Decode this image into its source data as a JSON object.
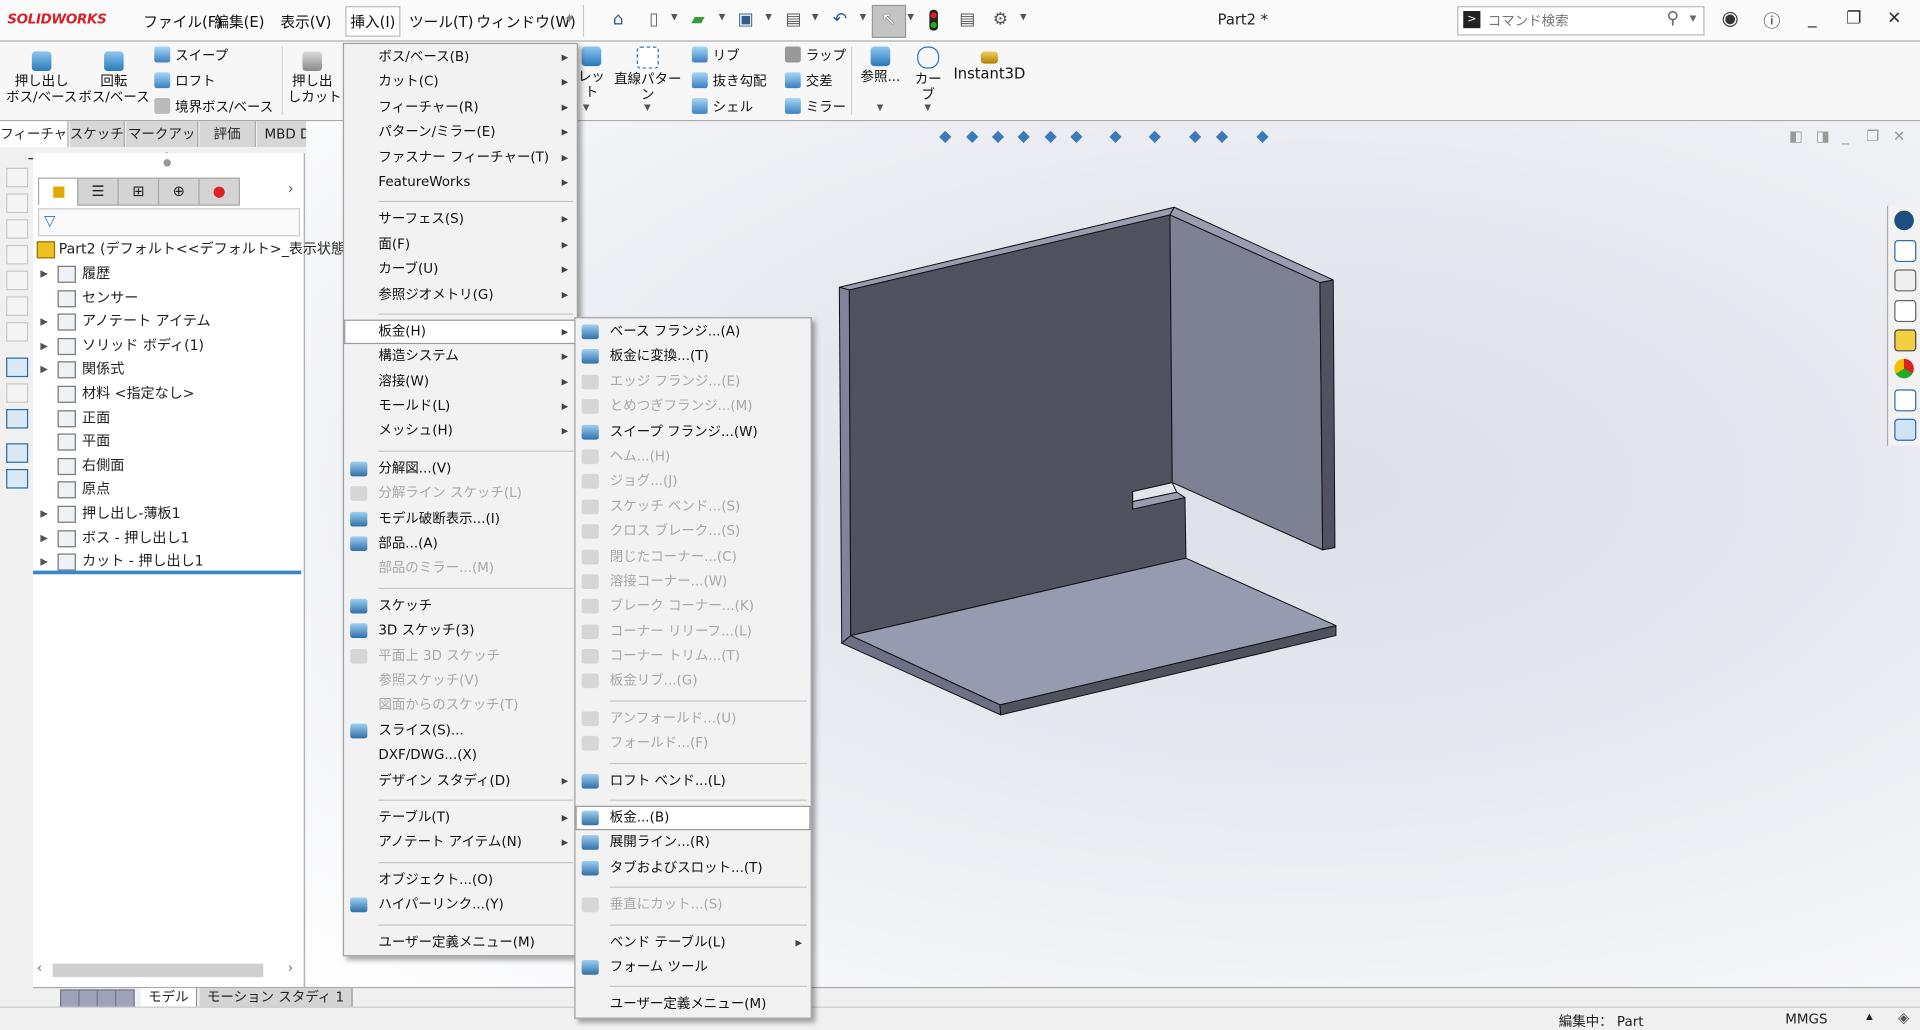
{
  "app": {
    "logo": "SOLIDWORKS",
    "doc_title": "Part2 *"
  },
  "menubar": [
    {
      "label": "ファイル(F)"
    },
    {
      "label": "編集(E)"
    },
    {
      "label": "表示(V)"
    },
    {
      "label": "挿入(I)",
      "active": true
    },
    {
      "label": "ツール(T)"
    },
    {
      "label": "ウィンドウ(W)"
    }
  ],
  "search": {
    "placeholder": "コマンド検索"
  },
  "ribbon": {
    "extrude_boss": "押し出し\nボス/ベース",
    "revolve_boss": "回転\nボス/ベース",
    "sweep": "スイープ",
    "loft": "ロフト",
    "boundary_boss": "境界ボス/ベース",
    "extrude_cut": "押し出\nしカット",
    "fillet": "レット",
    "linear_pattern": "直線パターン",
    "rib": "リブ",
    "draft": "抜き勾配",
    "shell": "シェル",
    "wrap": "ラップ",
    "intersect": "交差",
    "mirror": "ミラー",
    "reference": "参照...",
    "curves": "カーブ",
    "instant3d": "Instant3D"
  },
  "command_tabs": [
    "フィーチャー",
    "スケッチ",
    "マークアップ",
    "評価",
    "MBD Dime"
  ],
  "feature_tree": {
    "root": "Part2  (デフォルト<<デフォルト>_表示状態",
    "items": [
      {
        "label": "履歴",
        "expand": true
      },
      {
        "label": "センサー",
        "expand": false
      },
      {
        "label": "アノテート アイテム",
        "expand": true
      },
      {
        "label": "ソリッド ボディ(1)",
        "expand": true
      },
      {
        "label": "関係式",
        "expand": true
      },
      {
        "label": "材料 <指定なし>",
        "expand": false
      },
      {
        "label": "正面",
        "expand": false
      },
      {
        "label": "平面",
        "expand": false
      },
      {
        "label": "右側面",
        "expand": false
      },
      {
        "label": "原点",
        "expand": false
      },
      {
        "label": "押し出し-薄板1",
        "expand": true
      },
      {
        "label": "ボス - 押し出し1",
        "expand": true
      },
      {
        "label": "カット - 押し出し1",
        "expand": true
      }
    ]
  },
  "bottom_tabs": [
    "モデル",
    "モーション スタディ 1"
  ],
  "status": {
    "editing": "編集中： Part",
    "units": "MMGS"
  },
  "insert_menu": [
    {
      "label": "ボス/ベース(B)",
      "arrow": true
    },
    {
      "label": "カット(C)",
      "arrow": true
    },
    {
      "label": "フィーチャー(R)",
      "arrow": true
    },
    {
      "label": "パターン/ミラー(E)",
      "arrow": true
    },
    {
      "label": "ファスナー フィーチャー(T)",
      "arrow": true
    },
    {
      "label": "FeatureWorks",
      "arrow": true
    },
    {
      "sep": true
    },
    {
      "label": "サーフェス(S)",
      "arrow": true
    },
    {
      "label": "面(F)",
      "arrow": true
    },
    {
      "label": "カーブ(U)",
      "arrow": true
    },
    {
      "label": "参照ジオメトリ(G)",
      "arrow": true
    },
    {
      "sep": true
    },
    {
      "label": "板金(H)",
      "arrow": true,
      "highlight": true
    },
    {
      "label": "構造システム",
      "arrow": true
    },
    {
      "label": "溶接(W)",
      "arrow": true
    },
    {
      "label": "モールド(L)",
      "arrow": true
    },
    {
      "label": "メッシュ(H)",
      "arrow": true
    },
    {
      "sep": true
    },
    {
      "label": "分解図...(V)",
      "icon": "exploded-view-icon"
    },
    {
      "label": "分解ライン スケッチ(L)",
      "disabled": true,
      "icon": "explode-line-sketch-icon"
    },
    {
      "label": "モデル破断表示...(I)",
      "icon": "model-break-view-icon"
    },
    {
      "label": "部品...(A)",
      "icon": "part-icon"
    },
    {
      "label": "部品のミラー...(M)",
      "disabled": true
    },
    {
      "sep": true
    },
    {
      "label": "スケッチ",
      "icon": "sketch-icon"
    },
    {
      "label": "3D スケッチ(3)",
      "icon": "3d-sketch-icon"
    },
    {
      "label": "平面上 3D スケッチ",
      "disabled": true,
      "icon": "3d-sketch-on-plane-icon"
    },
    {
      "label": "参照スケッチ(V)",
      "disabled": true
    },
    {
      "label": "図面からのスケッチ(T)",
      "disabled": true
    },
    {
      "label": "スライス(S)...",
      "icon": "slice-icon"
    },
    {
      "label": "DXF/DWG...(X)"
    },
    {
      "label": "デザイン スタディ(D)",
      "arrow": true
    },
    {
      "sep": true
    },
    {
      "label": "テーブル(T)",
      "arrow": true
    },
    {
      "label": "アノテート アイテム(N)",
      "arrow": true
    },
    {
      "sep": true
    },
    {
      "label": "オブジェクト...(O)"
    },
    {
      "label": "ハイパーリンク...(Y)",
      "icon": "hyperlink-icon"
    },
    {
      "sep": true
    },
    {
      "label": "ユーザー定義メニュー(M)"
    }
  ],
  "sheetmetal_menu": [
    {
      "label": "ベース フランジ...(A)",
      "icon": "base-flange-icon"
    },
    {
      "label": "板金に変換...(T)",
      "icon": "convert-to-sheet-metal-icon"
    },
    {
      "label": "エッジ フランジ...(E)",
      "disabled": true,
      "icon": "edge-flange-icon"
    },
    {
      "label": "とめつぎフランジ...(M)",
      "disabled": true,
      "icon": "miter-flange-icon"
    },
    {
      "label": "スイープ フランジ...(W)",
      "icon": "swept-flange-icon"
    },
    {
      "label": "ヘム...(H)",
      "disabled": true,
      "icon": "hem-icon"
    },
    {
      "label": "ジョグ...(J)",
      "disabled": true,
      "icon": "jog-icon"
    },
    {
      "label": "スケッチ ベンド...(S)",
      "disabled": true,
      "icon": "sketched-bend-icon"
    },
    {
      "label": "クロス ブレーク...(S)",
      "disabled": true,
      "icon": "cross-break-icon"
    },
    {
      "label": "閉じたコーナー...(C)",
      "disabled": true,
      "icon": "closed-corner-icon"
    },
    {
      "label": "溶接コーナー...(W)",
      "disabled": true,
      "icon": "welded-corner-icon"
    },
    {
      "label": "ブレーク コーナー...(K)",
      "disabled": true,
      "icon": "break-corner-icon"
    },
    {
      "label": "コーナー リリーフ...(L)",
      "disabled": true,
      "icon": "corner-relief-icon"
    },
    {
      "label": "コーナー トリム...(T)",
      "disabled": true,
      "icon": "corner-trim-icon"
    },
    {
      "label": "板金リブ...(G)",
      "disabled": true,
      "icon": "sheet-metal-gusset-icon"
    },
    {
      "sep": true
    },
    {
      "label": "アンフォールド...(U)",
      "disabled": true,
      "icon": "unfold-icon"
    },
    {
      "label": "フォールド...(F)",
      "disabled": true,
      "icon": "fold-icon"
    },
    {
      "sep": true
    },
    {
      "label": "ロフト ベンド...(L)",
      "icon": "lofted-bend-icon"
    },
    {
      "sep": true
    },
    {
      "label": "板金...(B)",
      "icon": "sheet-metal-icon",
      "highlight": true
    },
    {
      "label": "展開ライン...(R)",
      "icon": "flatten-line-icon"
    },
    {
      "label": "タブおよびスロット...(T)",
      "icon": "tab-and-slot-icon"
    },
    {
      "sep": true
    },
    {
      "label": "垂直にカット...(S)",
      "disabled": true,
      "icon": "normal-cut-icon"
    },
    {
      "sep": true
    },
    {
      "label": "ベンド テーブル(L)",
      "arrow": true
    },
    {
      "label": "フォーム ツール",
      "icon": "forming-tool-icon"
    },
    {
      "sep": true
    },
    {
      "label": "ユーザー定義メニュー(M)"
    }
  ],
  "colors": {
    "accent": "#2a78b8",
    "model_dark": "#50525f",
    "model_mid": "#7e8094",
    "model_light": "#979bb0",
    "brand": "#d3242c"
  }
}
